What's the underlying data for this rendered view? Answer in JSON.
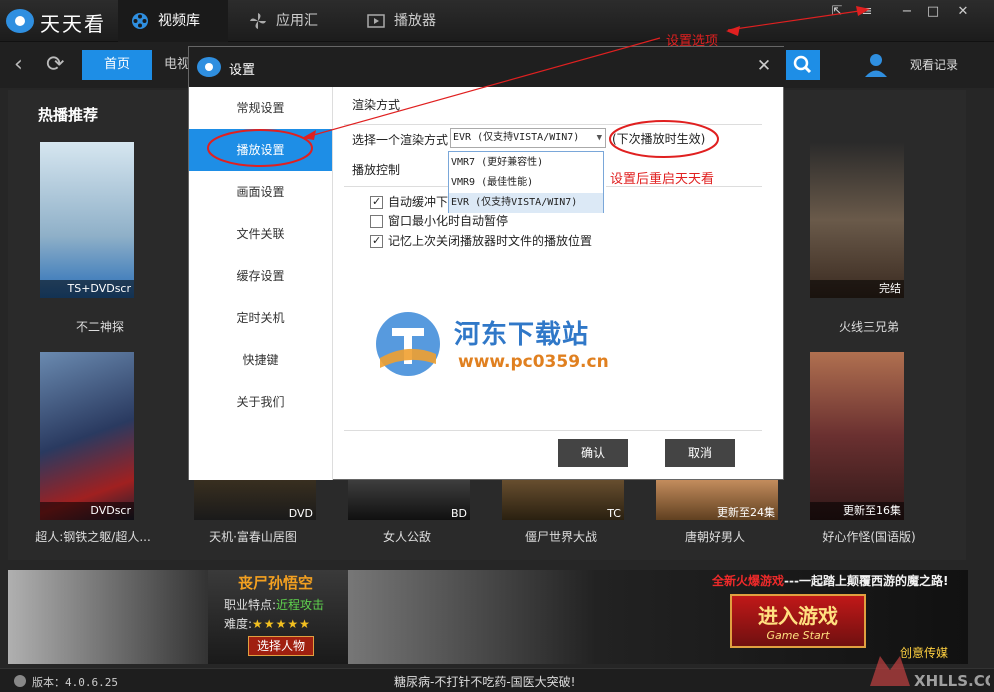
{
  "app": {
    "title": "天天看",
    "tabs": [
      {
        "label": "视频库",
        "icon": "film-reel-icon"
      },
      {
        "label": "应用汇",
        "icon": "pinwheel-icon"
      },
      {
        "label": "播放器",
        "icon": "play-screen-icon"
      }
    ]
  },
  "nav": {
    "home": "首页",
    "tv": "电视",
    "watch_history": "观看记录"
  },
  "section": {
    "title": "热播推荐"
  },
  "posters": [
    {
      "title": "不二神探",
      "badge": "TS+DVDscr"
    },
    {
      "title": "火线三兄弟",
      "badge": "完结"
    },
    {
      "title": "超人:钢铁之躯/超人...",
      "badge": "DVDscr"
    },
    {
      "title": "天机·富春山居图",
      "badge": "DVD"
    },
    {
      "title": "女人公敌",
      "badge": "BD"
    },
    {
      "title": "僵尸世界大战",
      "badge": "TC"
    },
    {
      "title": "唐朝好男人",
      "badge": "更新至24集"
    },
    {
      "title": "好心作怪(国语版)",
      "badge": "更新至16集"
    }
  ],
  "banner": {
    "game_title": "丧尸孙悟空",
    "traits_label": "职业特点:",
    "traits_value": "近程攻击",
    "difficulty_label": "难度:",
    "difficulty_stars": "★★★★★",
    "select_character": "选择人物",
    "promo_red": "全新火爆游戏",
    "promo_rest": "---一起踏上颠覆西游的魔之路!",
    "enter_game": "进入游戏",
    "game_start": "Game Start",
    "creative_media": "创意传媒"
  },
  "status": {
    "version": "版本：4.0.6.25",
    "ad": "糖尿病-不打针不吃药-国医大突破!"
  },
  "dialog": {
    "title": "设置",
    "sidebar": [
      "常规设置",
      "播放设置",
      "画面设置",
      "文件关联",
      "缓存设置",
      "定时关机",
      "快捷键",
      "关于我们"
    ],
    "render_section": "渲染方式",
    "render_choose_label": "选择一个渲染方式",
    "render_selected": "EVR (仅支持VISTA/WIN7)",
    "render_options": [
      "VMR7 (更好兼容性)",
      "VMR9 (最佳性能)",
      "EVR (仅支持VISTA/WIN7)"
    ],
    "render_note": "(下次播放时生效)",
    "playback_section": "播放控制",
    "checkboxes": [
      {
        "label": "自动缓冲下",
        "checked": true
      },
      {
        "label": "窗口最小化时自动暂停",
        "checked": false
      },
      {
        "label": "记忆上次关闭播放器时文件的播放位置",
        "checked": true
      }
    ],
    "ok": "确认",
    "cancel": "取消"
  },
  "annotations": {
    "settings_option": "设置选项",
    "restart_note": "设置后重启天天看"
  },
  "watermark": {
    "name": "河东下载站",
    "url": "www.pc0359.cn",
    "corner": "XHLLS.COM"
  },
  "colors": {
    "accent": "#1e8ee6",
    "annotation": "#e02020",
    "dark_bg": "#262626"
  }
}
